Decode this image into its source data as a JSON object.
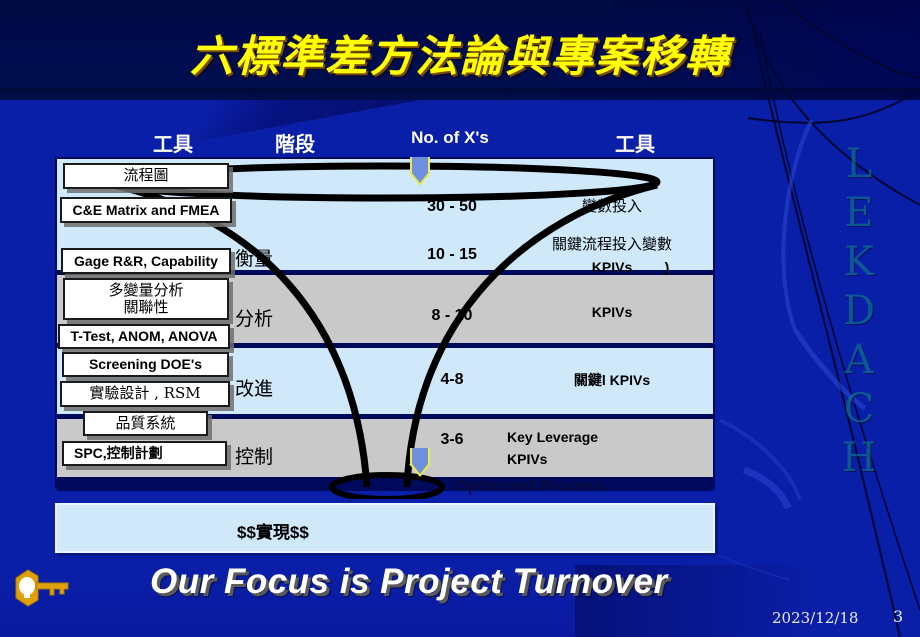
{
  "slide": {
    "title": "六標準差方法論與專案移轉",
    "watermark_letters": [
      "L",
      "E",
      "K",
      "D",
      "A",
      "C",
      "H"
    ],
    "colors": {
      "background": "#0a1fa8",
      "title_text": "#ffff00",
      "band_light": "#cfe9fb",
      "band_gray": "#c9c9c9",
      "band_separator": "#000a5c",
      "arrow_fill": "#6f90e0",
      "arrow_outline": "#e8ea50",
      "key_icon": "#e0a007"
    }
  },
  "headers": {
    "tools_left": "工具",
    "stage": "階段",
    "no_of_xs": "No. of X's",
    "tools_right": "工具"
  },
  "chart_data": {
    "type": "funnel",
    "title": "六標準差方法論與專案移轉",
    "stages": [
      {
        "stage": "衡量",
        "x_counts": [
          "30 - 50",
          "10 - 15"
        ],
        "output": "變數投入",
        "output2": "關鍵流程投入變數",
        "output3": "KPIVs",
        "output4": ")",
        "band": "light"
      },
      {
        "stage": "分析",
        "x_counts": [
          "8 - 10"
        ],
        "output": "KPIVs",
        "band": "gray"
      },
      {
        "stage": "改進",
        "x_counts": [
          "4-8"
        ],
        "output": "關鍵l KPIVs",
        "band": "light"
      },
      {
        "stage": "控制",
        "x_counts": [
          "3-6"
        ],
        "output": "Key Leverage\nKPIVs",
        "output_line1": "Key Leverage",
        "output_line2": "KPIVs",
        "band": "gray"
      }
    ],
    "values": [
      50,
      15,
      10,
      8,
      6
    ],
    "categories": [
      "30 - 50",
      "10 - 15",
      "8 - 10",
      "4-8",
      "3-6"
    ],
    "xlabel": "No. of X's",
    "ylabel": "階段",
    "annotation_bottom": "Optimized Process"
  },
  "tools_left": [
    {
      "label": "流程圖",
      "style": "serif"
    },
    {
      "label": "C&E Matrix and FMEA",
      "style": "sans"
    },
    {
      "label": "Gage R&R, Capability",
      "style": "sans"
    },
    {
      "label": "多變量分析\n關聯性",
      "line1": "多變量分析",
      "line2": "關聯性",
      "style": "serif"
    },
    {
      "label": "T-Test, ANOM, ANOVA",
      "style": "sans"
    },
    {
      "label": "Screening  DOE's",
      "style": "sans"
    },
    {
      "label": "實驗設計   , RSM",
      "style": "serif"
    },
    {
      "label": "品質系統",
      "style": "serif"
    },
    {
      "label": "SPC,控制計劃",
      "style": "sans"
    }
  ],
  "money_box": {
    "label": "$$實現$$"
  },
  "footer": {
    "tagline": "Our Focus is Project Turnover",
    "date": "2023/12/18",
    "page": "3"
  }
}
